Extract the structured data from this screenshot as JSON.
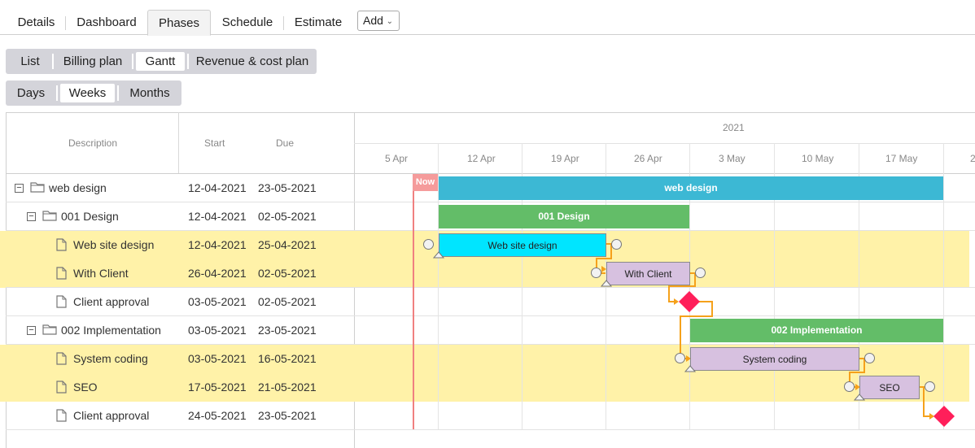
{
  "top_tabs": [
    "Details",
    "Dashboard",
    "Phases",
    "Schedule",
    "Estimate"
  ],
  "add_label": "Add",
  "view_tabs": [
    "List",
    "Billing plan",
    "Gantt",
    "Revenue & cost plan"
  ],
  "scale_tabs": [
    "Days",
    "Weeks",
    "Months"
  ],
  "grid_headers": {
    "description": "Description",
    "start": "Start",
    "due": "Due"
  },
  "timeline": {
    "year": "2021",
    "weeks": [
      "5 Apr",
      "12 Apr",
      "19 Apr",
      "26 Apr",
      "3 May",
      "10 May",
      "17 May",
      "2"
    ],
    "now_label": "Now"
  },
  "rows": [
    {
      "name": "web design",
      "start": "12-04-2021",
      "due": "23-05-2021"
    },
    {
      "name": "001 Design",
      "start": "12-04-2021",
      "due": "02-05-2021"
    },
    {
      "name": "Web site design",
      "start": "12-04-2021",
      "due": "25-04-2021"
    },
    {
      "name": "With Client",
      "start": "26-04-2021",
      "due": "02-05-2021"
    },
    {
      "name": "Client approval",
      "start": "03-05-2021",
      "due": "02-05-2021"
    },
    {
      "name": "002 Implementation",
      "start": "03-05-2021",
      "due": "23-05-2021"
    },
    {
      "name": "System coding",
      "start": "03-05-2021",
      "due": "16-05-2021"
    },
    {
      "name": "SEO",
      "start": "17-05-2021",
      "due": "21-05-2021"
    },
    {
      "name": "Client approval",
      "start": "24-05-2021",
      "due": "23-05-2021"
    }
  ],
  "bars": {
    "web_design": "web design",
    "design_001": "001 Design",
    "web_site_design": "Web site design",
    "with_client": "With Client",
    "impl_002": "002 Implementation",
    "system_coding": "System coding",
    "seo": "SEO"
  },
  "colors": {
    "project_bar": "#3cb8d4",
    "phase_bar": "#63bd68",
    "active_task": "#00e5ff",
    "task": "#d7c1e0",
    "milestone": "#ff1f5a",
    "dependency": "#f5a11b",
    "highlight_row": "#fff2a8",
    "now_line": "#f08080"
  }
}
